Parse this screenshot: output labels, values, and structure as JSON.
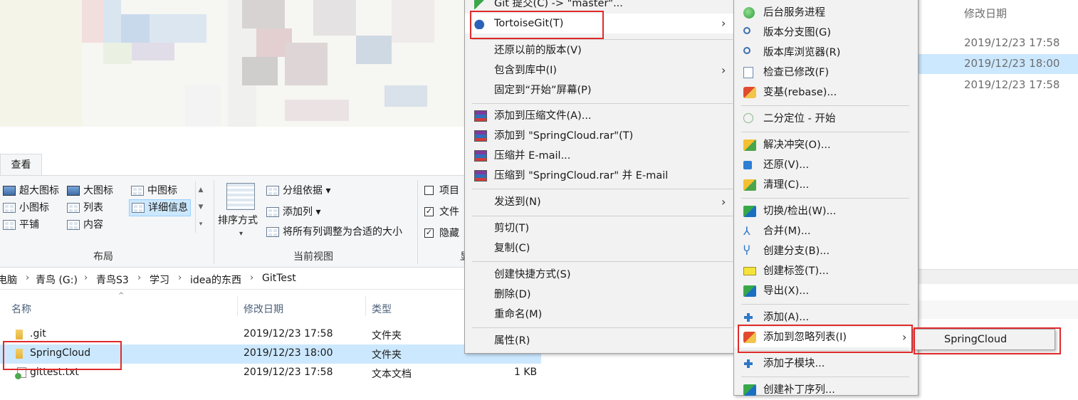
{
  "ribbon": {
    "tab_view": "查看",
    "layout": {
      "items": [
        "超大图标",
        "大图标",
        "中图标",
        "小图标",
        "列表",
        "详细信息",
        "平铺",
        "内容"
      ],
      "group_label": "布局"
    },
    "current_view": {
      "sort_label": "排序方式",
      "group_by": "分组依据",
      "add_column": "添加列",
      "fit_columns": "将所有列调整为合适的大小",
      "group_label": "当前视图"
    },
    "show_hide": {
      "item_checkbox": "项目",
      "ext_checkbox": "文件",
      "hidden_checkbox": "隐藏",
      "group_label": "显"
    }
  },
  "address": {
    "crumbs": [
      "电脑",
      "青鸟 (G:)",
      "青鸟S3",
      "学习",
      "idea的东西",
      "GitTest"
    ]
  },
  "filelist": {
    "headers": {
      "name": "名称",
      "modified": "修改日期",
      "type": "类型"
    },
    "rows": [
      {
        "name": ".git",
        "modified": "2019/12/23 17:58",
        "type": "文件夹",
        "size": ""
      },
      {
        "name": "SpringCloud",
        "modified": "2019/12/23 18:00",
        "type": "文件夹",
        "size": ""
      },
      {
        "name": "gittest.txt",
        "modified": "2019/12/23 17:58",
        "type": "文本文档",
        "size": "1 KB"
      }
    ]
  },
  "right_panel": {
    "header": "修改日期",
    "rows": [
      "2019/12/23 17:58",
      "2019/12/23 18:00",
      "2019/12/23 17:58"
    ]
  },
  "context_menu": {
    "git_commit": "Git 提交(C) -> \"master\"...",
    "tortoisegit": "TortoiseGit(T)",
    "restore_prev": "还原以前的版本(V)",
    "include_library": "包含到库中(I)",
    "pin_start": "固定到“开始”屏幕(P)",
    "add_archive": "添加到压缩文件(A)...",
    "add_rar": "添加到 \"SpringCloud.rar\"(T)",
    "compress_email": "压缩并 E-mail...",
    "compress_rar_email": "压缩到 \"SpringCloud.rar\" 并 E-mail",
    "send_to": "发送到(N)",
    "cut": "剪切(T)",
    "copy": "复制(C)",
    "create_shortcut": "创建快捷方式(S)",
    "delete": "删除(D)",
    "rename": "重命名(M)",
    "properties": "属性(R)"
  },
  "tgit_menu": {
    "daemon": "后台服务进程",
    "revision_graph": "版本分支图(G)",
    "repo_browser": "版本库浏览器(R)",
    "check_mods": "检查已修改(F)",
    "rebase": "变基(rebase)...",
    "bisect": "二分定位 - 开始",
    "resolve": "解决冲突(O)...",
    "revert": "还原(V)...",
    "clean": "清理(C)...",
    "switch": "切换/检出(W)...",
    "merge": "合并(M)...",
    "branch": "创建分支(B)...",
    "tag": "创建标签(T)...",
    "export": "导出(X)...",
    "add": "添加(A)...",
    "ignore": "添加到忽略列表(I)",
    "submodule": "添加子模块...",
    "partial": "创建补丁序列..."
  },
  "ignore_submenu": {
    "item": "SpringCloud"
  },
  "colors": {
    "selection": "#cce8ff",
    "highlight_box": "#e02a2a",
    "menu_bg": "#f2f2f2"
  }
}
